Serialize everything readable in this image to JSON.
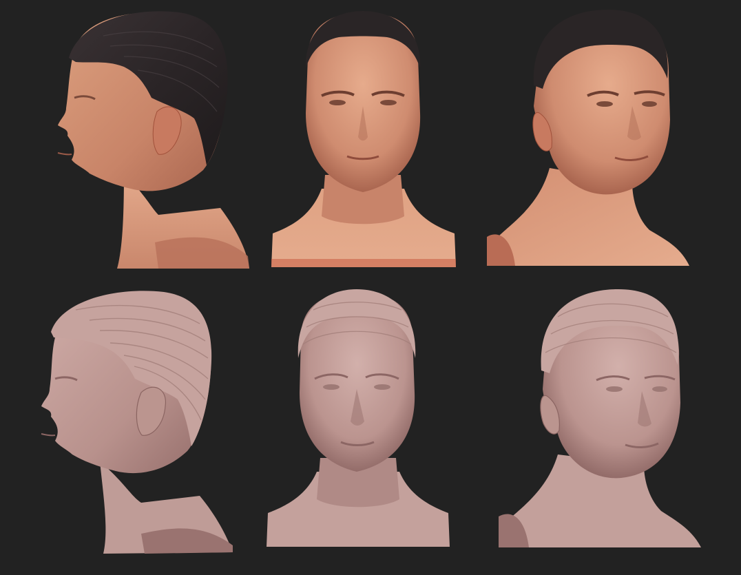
{
  "renders": [
    {
      "view": "profile-left",
      "material": "textured"
    },
    {
      "view": "front",
      "material": "textured"
    },
    {
      "view": "three-quarter-right",
      "material": "textured"
    },
    {
      "view": "profile-left",
      "material": "clay"
    },
    {
      "view": "front",
      "material": "clay"
    },
    {
      "view": "three-quarter-right",
      "material": "clay"
    }
  ],
  "colors": {
    "background": "#222222",
    "skin_light": "#e0a183",
    "skin_mid": "#c4826a",
    "skin_dark": "#9a5a48",
    "hair": "#2a2526",
    "hair_highlight": "#4a4043",
    "clay_light": "#c9a7a2",
    "clay_mid": "#b28a86",
    "clay_dark": "#8c6664",
    "rim": "#c0451f"
  }
}
